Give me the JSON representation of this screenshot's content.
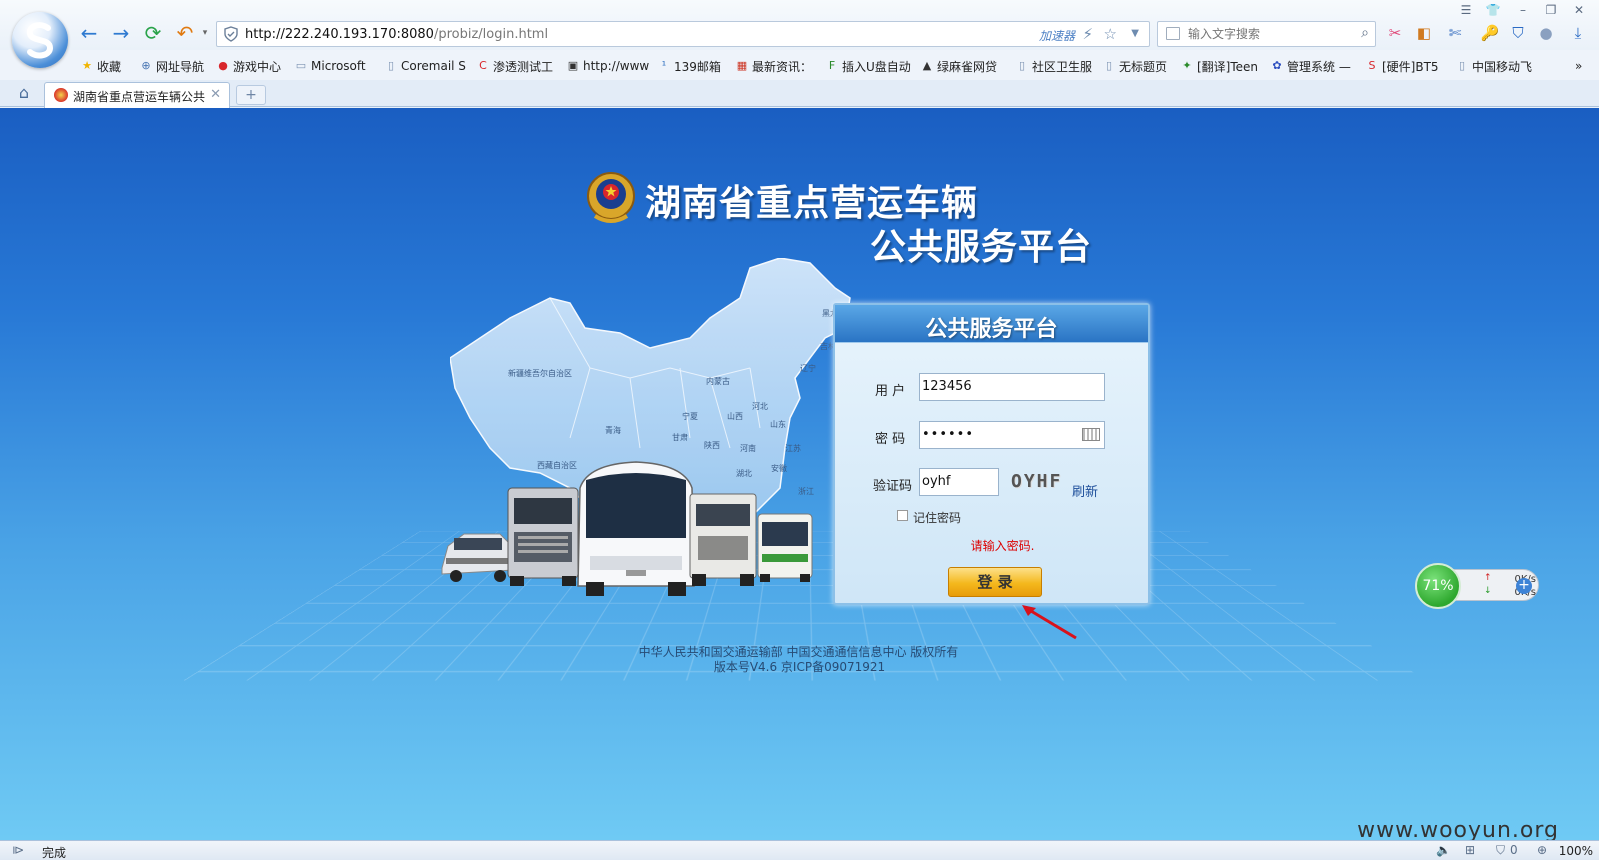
{
  "browser": {
    "address_host": "http://222.240.193.170:8080",
    "address_path": "/probiz/login.html",
    "accelerator_label": "加速器",
    "search_placeholder": "输入文字搜索",
    "tab_title": "湖南省重点营运车辆公共",
    "status_text": "完成",
    "zoom_text": "100%",
    "status_count": "0"
  },
  "bookmarks": [
    {
      "label": "收藏",
      "icon": "star-icon",
      "color": "#f0b400"
    },
    {
      "label": "网址导航",
      "icon": "globe-icon",
      "color": "#4a77b4"
    },
    {
      "label": "游戏中心",
      "icon": "game-icon",
      "color": "#d8262c"
    },
    {
      "label": "Microsoft",
      "icon": "folder-icon",
      "color": "#7d93b3"
    },
    {
      "label": "Coremail S",
      "icon": "page-icon",
      "color": "#7d93b3"
    },
    {
      "label": "渗透测试工",
      "icon": "c-icon",
      "color": "#d8262c"
    },
    {
      "label": "http://www",
      "icon": "site-icon",
      "color": "#333"
    },
    {
      "label": "139邮箱",
      "icon": "139-icon",
      "color": "#2d6fc0"
    },
    {
      "label": "最新资讯：",
      "icon": "news-icon",
      "color": "#cc3322"
    },
    {
      "label": "插入U盘自动",
      "icon": "f-icon",
      "color": "#2a8a2a"
    },
    {
      "label": "绿麻雀网贷",
      "icon": "sparrow-icon",
      "color": "#333"
    },
    {
      "label": "社区卫生服",
      "icon": "page-icon",
      "color": "#7d93b3"
    },
    {
      "label": "无标题页",
      "icon": "page-icon",
      "color": "#7d93b3"
    },
    {
      "label": "[翻译]Teen",
      "icon": "translate-icon",
      "color": "#2a8a2a"
    },
    {
      "label": "管理系统 —",
      "icon": "paw-icon",
      "color": "#2d4fc0"
    },
    {
      "label": "[硬件]BT5",
      "icon": "s-icon",
      "color": "#d8262c"
    },
    {
      "label": "中国移动飞",
      "icon": "page-icon",
      "color": "#7d93b3"
    }
  ],
  "page": {
    "title_line1": "湖南省重点营运车辆",
    "title_line2": "公共服务平台",
    "panel_title": "公共服务平台",
    "user_label": "用 户",
    "user_value": "123456",
    "password_label": "密 码",
    "password_value": "••••••",
    "captcha_label": "验证码",
    "captcha_value": "oyhf",
    "captcha_image_text": "OYHF",
    "refresh_label": "刷新",
    "remember_label": "记住密码",
    "error_message": "请输入密码.",
    "login_button": "登 录",
    "footer_line1": "中华人民共和国交通运输部 中国交通通信信息中心 版权所有",
    "footer_line2": "版本号V4.6 京ICP备09071921",
    "provinces": [
      "新疆维吾尔自治区",
      "内蒙古",
      "辽宁",
      "吉林",
      "黑龙",
      "青海",
      "宁夏",
      "山西",
      "河北",
      "甘肃",
      "陕西",
      "河南",
      "山东",
      "西藏自治区",
      "湖北",
      "安徽",
      "江苏",
      "浙江"
    ]
  },
  "speed_widget": {
    "percent": "71%",
    "up": "0K/s",
    "down": "0K/s"
  },
  "watermark": "www.wooyun.org",
  "colors": {
    "accent": "#2f7ad0",
    "error": "#dd0000",
    "button": "#f4b81d"
  }
}
